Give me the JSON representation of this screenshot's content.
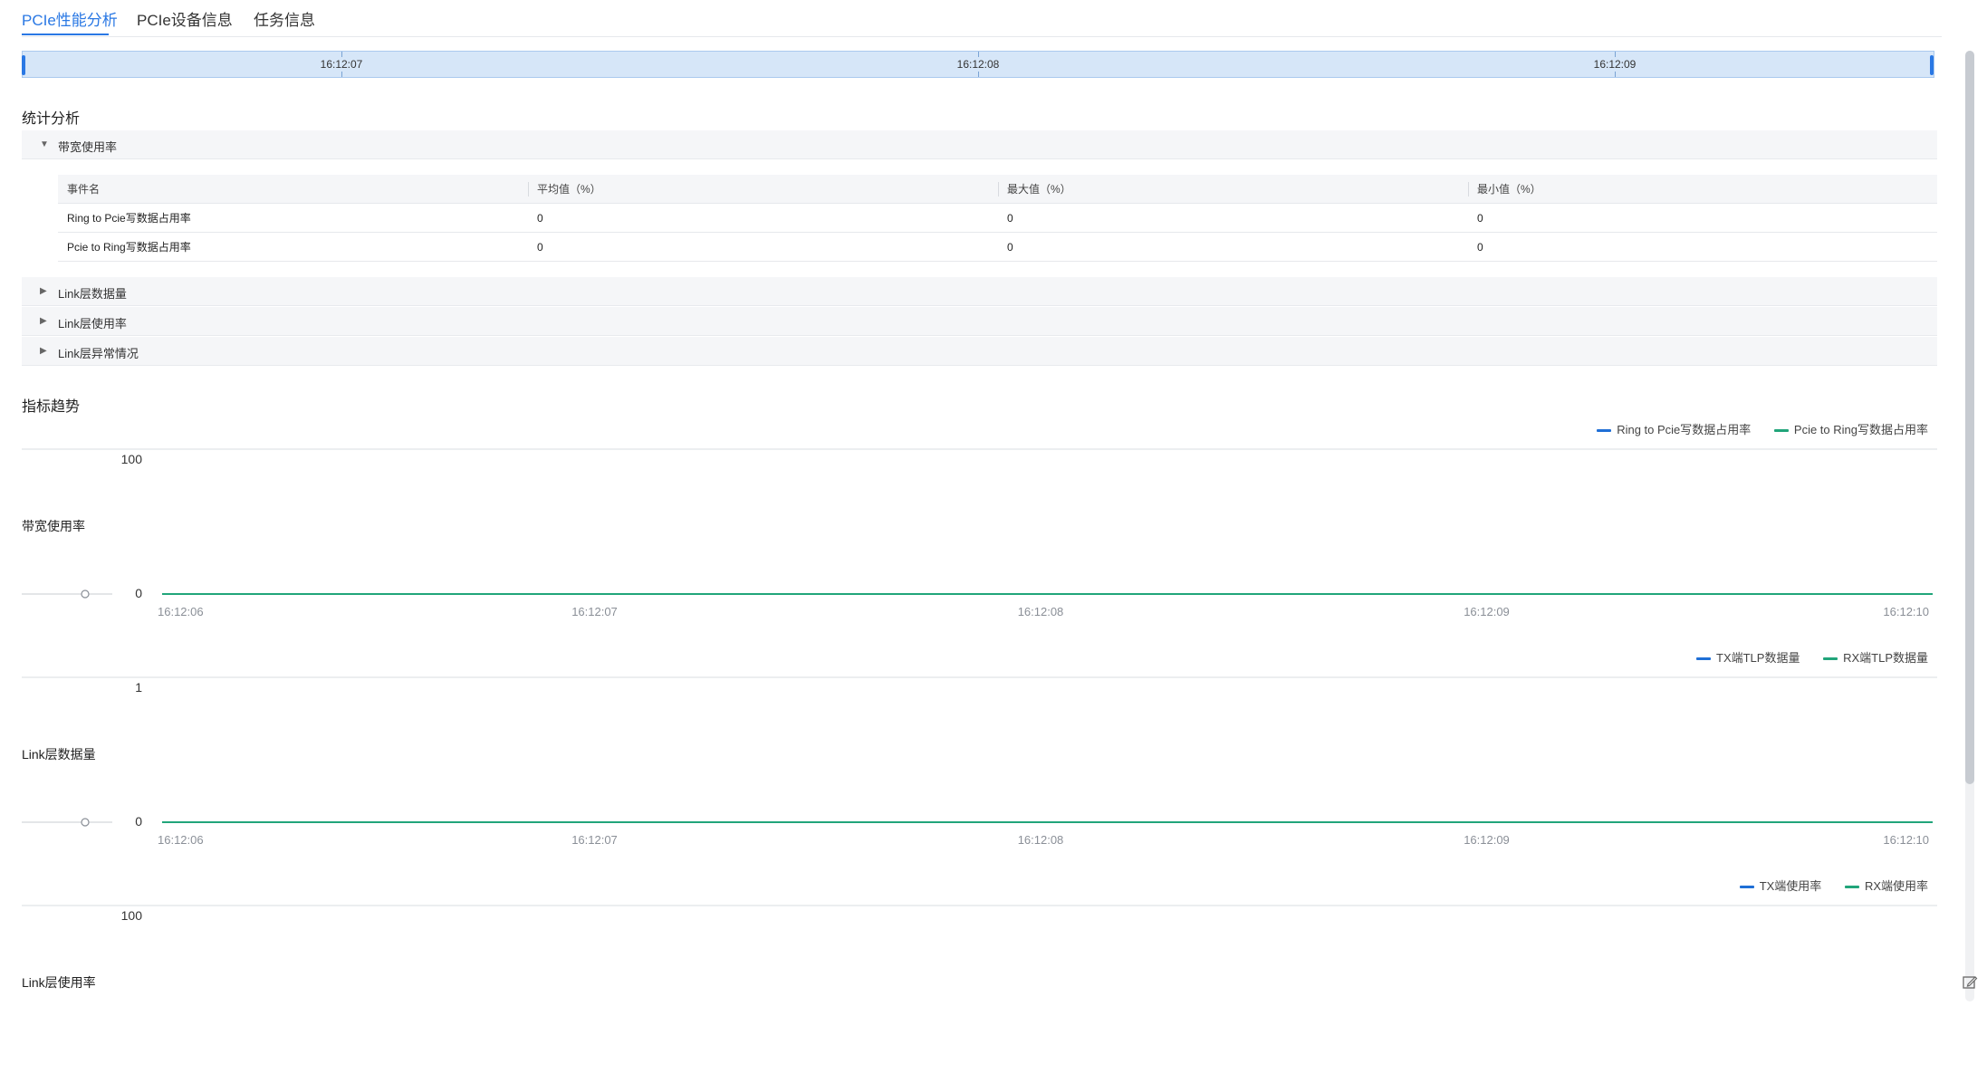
{
  "tabs": [
    {
      "label": "PCIe性能分析",
      "active": true
    },
    {
      "label": "PCIe设备信息",
      "active": false
    },
    {
      "label": "任务信息",
      "active": false
    }
  ],
  "timeline": {
    "ticks": [
      "16:12:07",
      "16:12:08",
      "16:12:09"
    ]
  },
  "stats": {
    "title": "统计分析",
    "panels": {
      "bandwidth": {
        "label": "带宽使用率",
        "expanded": true
      },
      "link_data": {
        "label": "Link层数据量",
        "expanded": false
      },
      "link_usage": {
        "label": "Link层使用率",
        "expanded": false
      },
      "link_errors": {
        "label": "Link层异常情况",
        "expanded": false
      }
    },
    "table": {
      "headers": [
        "事件名",
        "平均值（%）",
        "最大值（%）",
        "最小值（%）"
      ],
      "rows": [
        [
          "Ring to Pcie写数据占用率",
          "0",
          "0",
          "0"
        ],
        [
          "Pcie to Ring写数据占用率",
          "0",
          "0",
          "0"
        ]
      ]
    }
  },
  "trends": {
    "title": "指标趋势"
  },
  "charts": [
    {
      "name": "带宽使用率",
      "y_ticks": [
        "100",
        "0"
      ],
      "x_ticks": [
        "16:12:06",
        "16:12:07",
        "16:12:08",
        "16:12:09",
        "16:12:10"
      ],
      "legend": [
        {
          "label": "Ring to Pcie写数据占用率",
          "color": "#1f6fd6"
        },
        {
          "label": "Pcie to Ring写数据占用率",
          "color": "#21a57a"
        }
      ]
    },
    {
      "name": "Link层数据量",
      "y_ticks": [
        "1",
        "0"
      ],
      "x_ticks": [
        "16:12:06",
        "16:12:07",
        "16:12:08",
        "16:12:09",
        "16:12:10"
      ],
      "legend": [
        {
          "label": "TX端TLP数据量",
          "color": "#1f6fd6"
        },
        {
          "label": "RX端TLP数据量",
          "color": "#21a57a"
        }
      ]
    },
    {
      "name": "Link层使用率",
      "y_ticks": [
        "100"
      ],
      "x_ticks": [],
      "legend": [
        {
          "label": "TX端使用率",
          "color": "#1f6fd6"
        },
        {
          "label": "RX端使用率",
          "color": "#21a57a"
        }
      ]
    }
  ],
  "chart_data": [
    {
      "type": "line",
      "title": "",
      "ylabel": "带宽使用率",
      "xlabel": "",
      "ylim": [
        0,
        100
      ],
      "x": [
        "16:12:06",
        "16:12:07",
        "16:12:08",
        "16:12:09",
        "16:12:10"
      ],
      "series": [
        {
          "name": "Ring to Pcie写数据占用率",
          "values": [
            0,
            0,
            0,
            0,
            0
          ]
        },
        {
          "name": "Pcie to Ring写数据占用率",
          "values": [
            0,
            0,
            0,
            0,
            0
          ]
        }
      ],
      "legend": "top-right",
      "grid": false
    },
    {
      "type": "line",
      "title": "",
      "ylabel": "Link层数据量",
      "xlabel": "",
      "ylim": [
        0,
        1
      ],
      "x": [
        "16:12:06",
        "16:12:07",
        "16:12:08",
        "16:12:09",
        "16:12:10"
      ],
      "series": [
        {
          "name": "TX端TLP数据量",
          "values": [
            0,
            0,
            0,
            0,
            0
          ]
        },
        {
          "name": "RX端TLP数据量",
          "values": [
            0,
            0,
            0,
            0,
            0
          ]
        }
      ],
      "legend": "top-right",
      "grid": false
    },
    {
      "type": "line",
      "title": "",
      "ylabel": "Link层使用率",
      "xlabel": "",
      "ylim": [
        0,
        100
      ],
      "x": [],
      "series": [
        {
          "name": "TX端使用率",
          "values": []
        },
        {
          "name": "RX端使用率",
          "values": []
        }
      ],
      "legend": "top-right",
      "grid": false
    }
  ]
}
